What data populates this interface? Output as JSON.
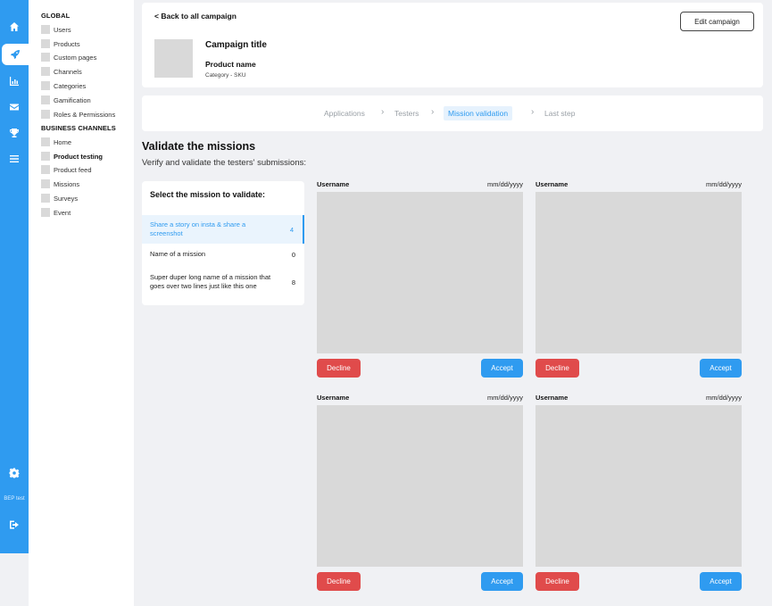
{
  "rail": {
    "user_label": "BEP test",
    "icons": [
      "home-icon",
      "rocket-icon",
      "chart-icon",
      "mail-icon",
      "trophy-icon",
      "menu-icon",
      "gear-icon",
      "logout-icon"
    ]
  },
  "nav": {
    "global_heading": "GLOBAL",
    "global_items": [
      "Users",
      "Products",
      "Custom pages",
      "Channels",
      "Categories",
      "Gamification",
      "Roles & Permissions"
    ],
    "business_heading": "BUSINESS CHANNELS",
    "business_items": [
      "Home",
      "Product testing",
      "Product feed",
      "Missions",
      "Surveys",
      "Event"
    ],
    "active_item": "Product testing"
  },
  "header": {
    "back_label": "< Back to all campaign",
    "edit_label": "Edit campaign",
    "campaign_title": "Campaign title",
    "product_name": "Product name",
    "category_sku": "Category - SKU"
  },
  "steps": {
    "items": [
      "Applications",
      "Testers",
      "Mission validation",
      "Last step"
    ],
    "active": "Mission validation",
    "separator": "›"
  },
  "page": {
    "title": "Validate the missions",
    "subtitle": "Verify and validate the testers' submissions:"
  },
  "missions": {
    "heading": "Select the mission to validate:",
    "items": [
      {
        "label": "Share a story on insta & share a screenshot",
        "count": "4"
      },
      {
        "label": "Name of a mission",
        "count": "0"
      },
      {
        "label": "Super duper long name of a mission that goes over two lines just like this one",
        "count": "8"
      }
    ]
  },
  "submissions": [
    {
      "username": "Username",
      "date": "mm/dd/yyyy",
      "decline_label": "Decline",
      "accept_label": "Accept"
    },
    {
      "username": "Username",
      "date": "mm/dd/yyyy",
      "decline_label": "Decline",
      "accept_label": "Accept"
    },
    {
      "username": "Username",
      "date": "mm/dd/yyyy",
      "decline_label": "Decline",
      "accept_label": "Accept"
    },
    {
      "username": "Username",
      "date": "mm/dd/yyyy",
      "decline_label": "Decline",
      "accept_label": "Accept"
    }
  ],
  "colors": {
    "accent": "#2f9bf0",
    "decline": "#e04b4b",
    "placeholder": "#d9d9d9",
    "background": "#f0f1f4"
  }
}
